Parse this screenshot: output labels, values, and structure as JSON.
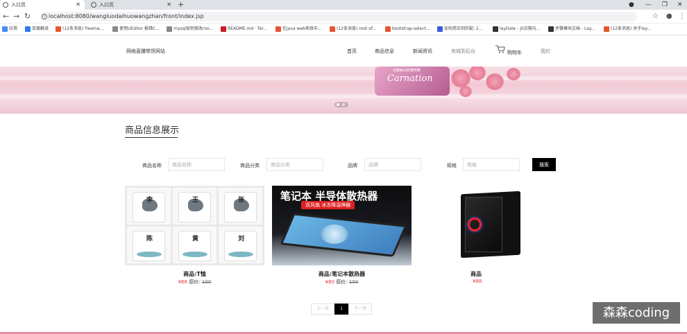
{
  "browser": {
    "tabs": [
      {
        "title": "入口页",
        "active": true
      },
      {
        "title": "入口页",
        "active": false
      }
    ],
    "new_tab": "+",
    "window_controls": {
      "minimize": "—",
      "maximize": "❐",
      "close": "✕"
    },
    "url": "localhost:8080/wangluodaihuowangzhan/front/index.jsp",
    "bookmarks": [
      {
        "label": "应用",
        "color": "#4a8af4"
      },
      {
        "label": "百度翻译",
        "color": "#2e7be6"
      },
      {
        "label": "(12条消息) freema...",
        "color": "#e4572e"
      },
      {
        "label": "使用UEditor 报错C...",
        "color": "#888888"
      },
      {
        "label": "mysql如何修改roo...",
        "color": "#888888"
      },
      {
        "label": "README.md · Ter...",
        "color": "#c71d23"
      },
      {
        "label": "在java web项目中...",
        "color": "#e4572e"
      },
      {
        "label": "(12条消息) root of...",
        "color": "#e4572e"
      },
      {
        "label": "bootstrap-select...",
        "color": "#e4572e"
      },
      {
        "label": "如何用正则匹配: 2...",
        "color": "#3b5bdb"
      },
      {
        "label": "layDate - JS日期与...",
        "color": "#333333"
      },
      {
        "label": "步骤模块文档 - Lay...",
        "color": "#333333"
      },
      {
        "label": "(12条消息) 关于lay...",
        "color": "#e4572e"
      }
    ]
  },
  "header": {
    "site_name": "网络直播带货网站",
    "nav": [
      "首页",
      "商品信息",
      "新闻资讯",
      "商城到后台",
      "购物车",
      "我的"
    ]
  },
  "banner": {
    "brand": "Carnation",
    "small_text": "花瓣美白防晒喷雾",
    "slide_count": 2,
    "active_slide": 1
  },
  "section": {
    "title": "商品信息展示"
  },
  "search": {
    "fields": [
      {
        "label": "商品名称",
        "placeholder": "商品名称"
      },
      {
        "label": "商品分类",
        "placeholder": "商品分类"
      },
      {
        "label": "品牌",
        "placeholder": "品牌"
      },
      {
        "label": "规格",
        "placeholder": "规格"
      }
    ],
    "button": "搜索"
  },
  "products": [
    {
      "name": "商品:T恤",
      "price_prefix": "¥66",
      "orig_label": "原价:",
      "orig": "100",
      "tee_chars": [
        "李",
        "王",
        "张",
        "陈",
        "黄",
        "刘"
      ]
    },
    {
      "name": "商品:笔记本散热器",
      "price_prefix": "¥80",
      "orig_label": "原价:",
      "orig": "100",
      "headline": "笔记本 半导体散热器",
      "sub": "双风扇 冰冻降温神器"
    },
    {
      "name": "商品",
      "price_prefix": "¥88",
      "orig_label": "",
      "orig": ""
    }
  ],
  "pager": {
    "prev": "上一页",
    "current": "1",
    "next": "下一页"
  },
  "watermark": "森森coding"
}
